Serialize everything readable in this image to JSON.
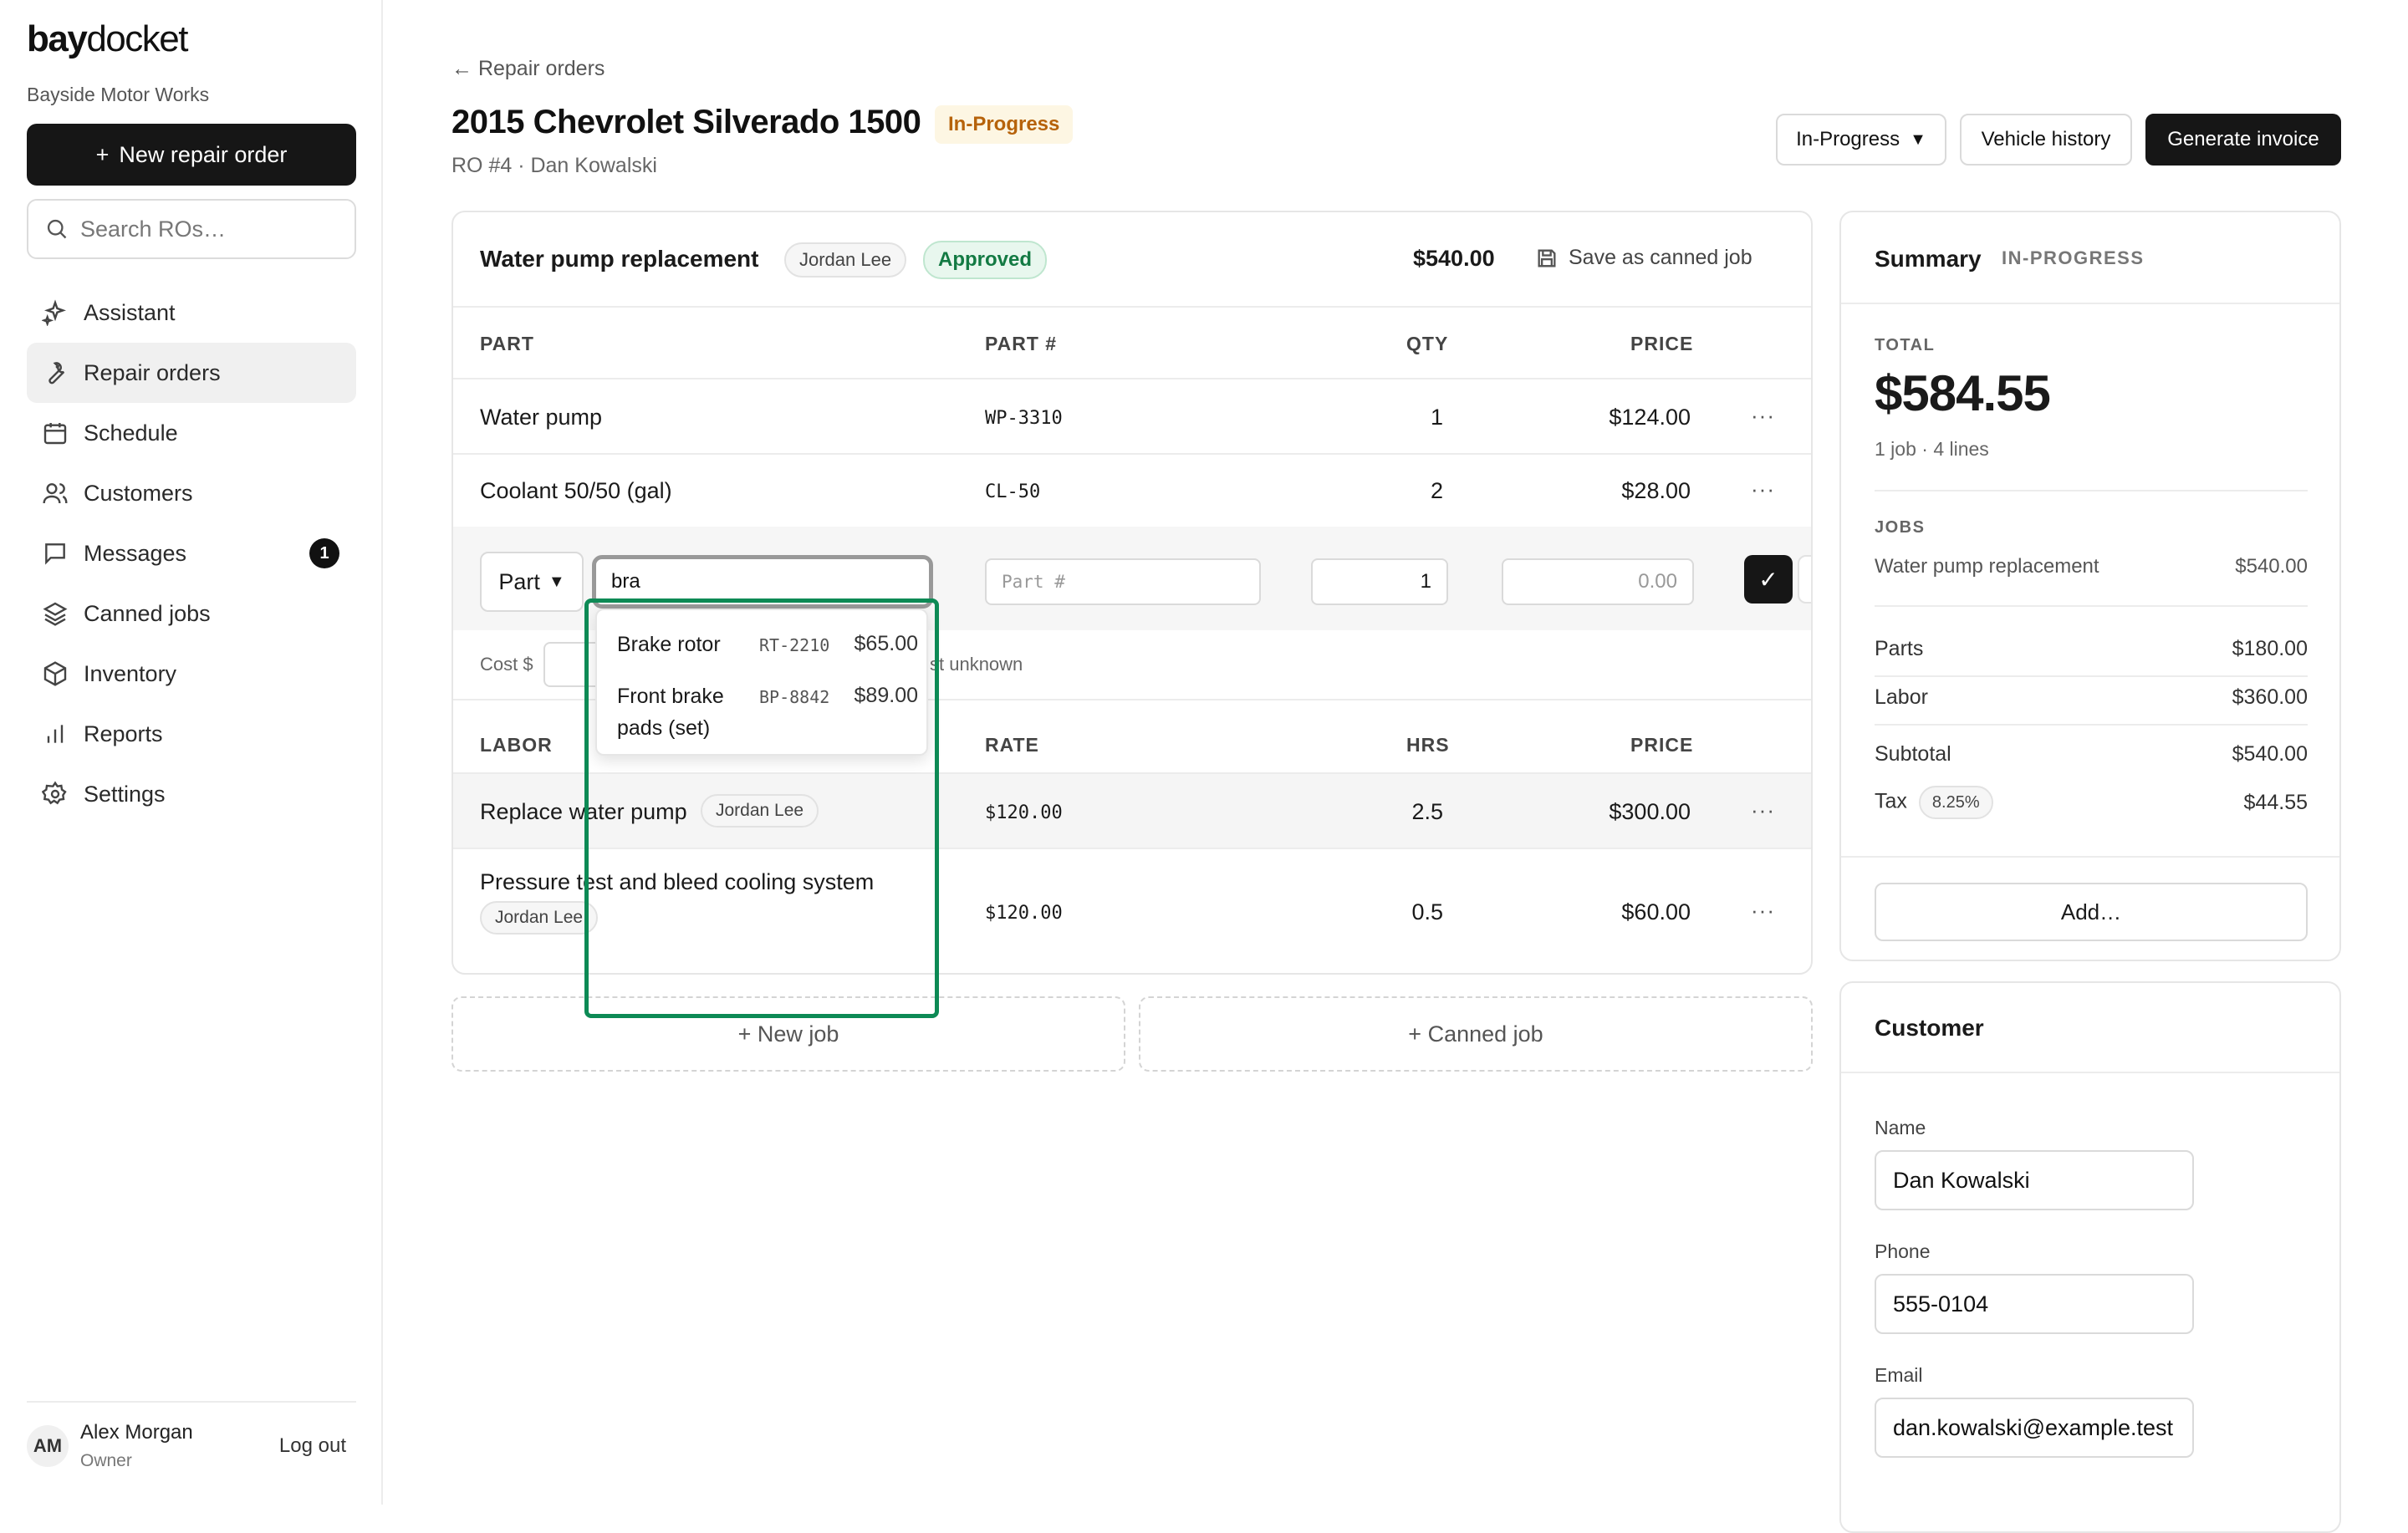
{
  "sidebar": {
    "brand_bold": "bay",
    "brand_rest": "docket",
    "shop": "Bayside Motor Works",
    "new_ro_label": "New repair order",
    "search_placeholder": "Search ROs…",
    "nav": [
      {
        "label": "Assistant",
        "icon": "sparkle-icon"
      },
      {
        "label": "Repair orders",
        "icon": "wrench-icon",
        "active": true
      },
      {
        "label": "Schedule",
        "icon": "calendar-icon"
      },
      {
        "label": "Customers",
        "icon": "users-icon"
      },
      {
        "label": "Messages",
        "icon": "message-icon",
        "badge": "1"
      },
      {
        "label": "Canned jobs",
        "icon": "layers-icon"
      },
      {
        "label": "Inventory",
        "icon": "box-icon"
      },
      {
        "label": "Reports",
        "icon": "bar-chart-icon"
      },
      {
        "label": "Settings",
        "icon": "gear-icon"
      }
    ],
    "user": {
      "initials": "AM",
      "name": "Alex Morgan",
      "role": "Owner",
      "logout": "Log out"
    }
  },
  "header": {
    "back": "← Repair orders",
    "title": "2015 Chevrolet Silverado 1500",
    "status": "In-Progress",
    "subtitle": "RO #4 · Dan Kowalski",
    "status_select": "In-Progress",
    "vehicle_history": "Vehicle history",
    "generate_invoice": "Generate invoice"
  },
  "job": {
    "title": "Water pump replacement",
    "tech": "Jordan Lee",
    "approval": "Approved",
    "total": "$540.00",
    "save_canned": "Save as canned job",
    "parts_headers": {
      "part": "PART",
      "part_no": "PART #",
      "qty": "QTY",
      "price": "PRICE"
    },
    "parts": [
      {
        "name": "Water pump",
        "part_no": "WP-3310",
        "qty": "1",
        "price": "$124.00"
      },
      {
        "name": "Coolant 50/50 (gal)",
        "part_no": "CL-50",
        "qty": "2",
        "price": "$28.00"
      }
    ],
    "new_line": {
      "type": "Part",
      "search_value": "bra",
      "part_no_placeholder": "Part #",
      "qty_value": "1",
      "price_placeholder": "0.00",
      "cost_label": "Cost $",
      "cost_note": "st unknown"
    },
    "suggestions": [
      {
        "name": "Brake rotor",
        "part_no": "RT-2210",
        "price": "$65.00"
      },
      {
        "name": "Front brake pads (set)",
        "part_no": "BP-8842",
        "price": "$89.00"
      }
    ],
    "labor_headers": {
      "labor": "LABOR",
      "rate": "RATE",
      "hrs": "HRS",
      "price": "PRICE"
    },
    "labor": [
      {
        "name": "Replace water pump",
        "tech": "Jordan Lee",
        "rate": "$120.00",
        "hrs": "2.5",
        "price": "$300.00"
      },
      {
        "name": "Pressure test and bleed cooling system",
        "tech": "Jordan Lee",
        "rate": "$120.00",
        "hrs": "0.5",
        "price": "$60.00"
      }
    ]
  },
  "actions": {
    "new_job": "+ New job",
    "canned_job": "+ Canned job"
  },
  "summary": {
    "title": "Summary",
    "status": "IN-PROGRESS",
    "total_label": "TOTAL",
    "total": "$584.55",
    "meta": "1 job · 4 lines",
    "jobs_label": "JOBS",
    "jobs": [
      {
        "name": "Water pump replacement",
        "amount": "$540.00"
      }
    ],
    "parts_label": "Parts",
    "parts": "$180.00",
    "labor_label": "Labor",
    "labor": "$360.00",
    "subtotal_label": "Subtotal",
    "subtotal": "$540.00",
    "tax_label": "Tax",
    "tax_rate": "8.25%",
    "tax": "$44.55",
    "add": "Add…"
  },
  "customer": {
    "title": "Customer",
    "name_label": "Name",
    "name": "Dan Kowalski",
    "phone_label": "Phone",
    "phone": "555-0104",
    "email_label": "Email",
    "email": "dan.kowalski@example.test"
  },
  "colors": {
    "accent_dark": "#161616",
    "status_amber": "#b6620a",
    "approved_green": "#137a43",
    "highlight_green": "#0d8a55"
  }
}
